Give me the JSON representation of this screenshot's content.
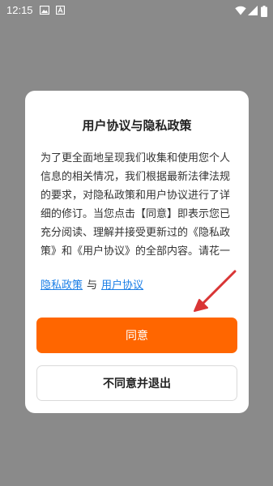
{
  "status_bar": {
    "time": "12:15",
    "icons": [
      "image-icon",
      "app-a-icon",
      "wifi-icon",
      "signal-icon",
      "battery-icon"
    ]
  },
  "dialog": {
    "title": "用户协议与隐私政策",
    "body": "为了更全面地呈现我们收集和使用您个人信息的相关情况，我们根据最新法律法规的要求，对隐私政策和用户协议进行了详细的修订。当您点击【同意】即表示您已充分阅读、理解并接受更新过的《隐私政策》和《用户协议》的全部内容。请花一",
    "privacy_link": "隐私政策",
    "link_separator": "与",
    "user_agreement_link": "用户协议",
    "agree_button": "同意",
    "decline_button": "不同意并退出"
  },
  "colors": {
    "accent": "#ff6600",
    "link": "#1a7ee6",
    "arrow": "#d93535",
    "backdrop": "#8a8a8a"
  }
}
